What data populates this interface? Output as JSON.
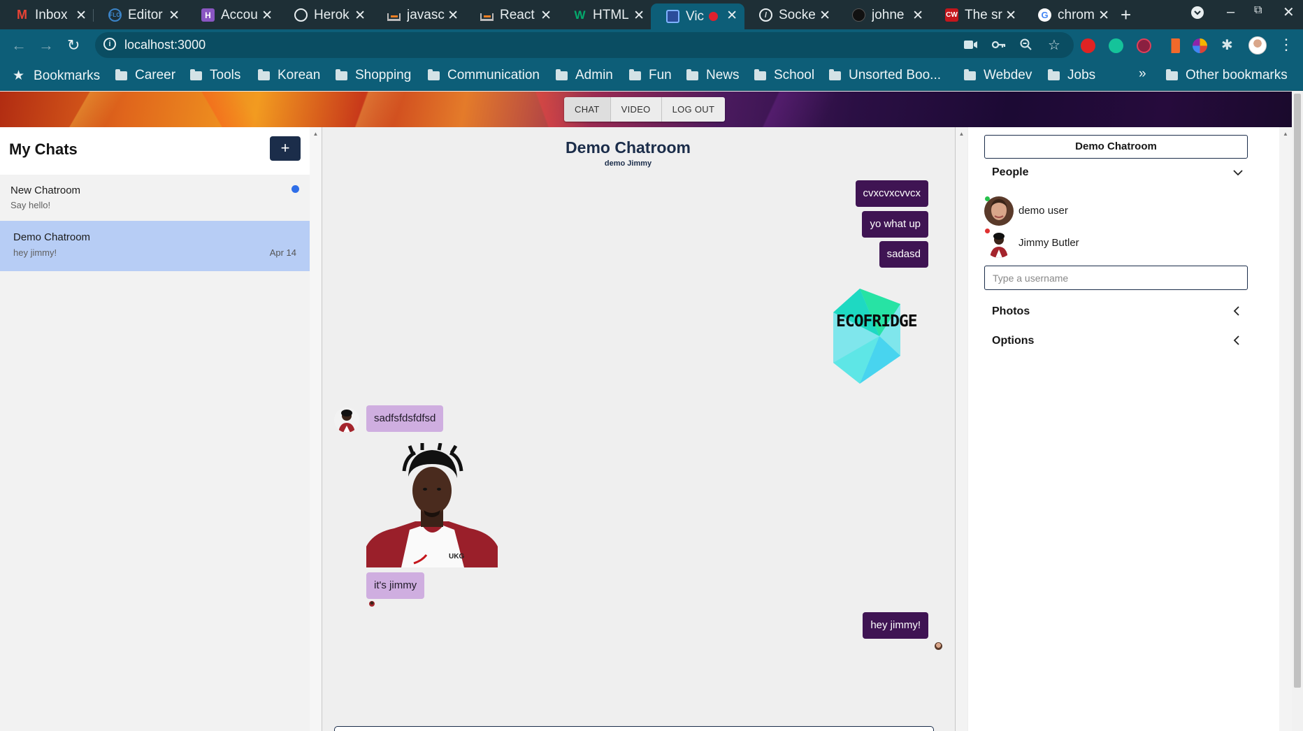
{
  "browser": {
    "tabs": [
      {
        "title": "Inbox",
        "favicon": "gmail-icon",
        "color": "#ea4335",
        "glyph": "M"
      },
      {
        "title": "Editor",
        "favicon": "flo-icon",
        "color": "#3b84c8",
        "glyph": "F"
      },
      {
        "title": "Accou",
        "favicon": "heroku-icon",
        "color": "#8a56c2",
        "glyph": "H"
      },
      {
        "title": "Herok",
        "favicon": "globe-icon",
        "color": "#e8eef0",
        "glyph": ""
      },
      {
        "title": "javasc",
        "favicon": "stackoverflow-icon",
        "color": "#f48024",
        "glyph": ""
      },
      {
        "title": "React",
        "favicon": "stackoverflow-icon",
        "color": "#f48024",
        "glyph": ""
      },
      {
        "title": "HTML",
        "favicon": "w3schools-icon",
        "color": "#04aa6d",
        "glyph": "W"
      },
      {
        "title": "Vic",
        "favicon": "app-icon",
        "color": "#5b8def",
        "glyph": "",
        "active": true,
        "recording": true
      },
      {
        "title": "Socke",
        "favicon": "compass-icon",
        "color": "#e8eef0",
        "glyph": ""
      },
      {
        "title": "johne",
        "favicon": "github-icon",
        "color": "#222",
        "glyph": ""
      },
      {
        "title": "The sr",
        "favicon": "cw-icon",
        "color": "#c4161c",
        "glyph": "CW"
      },
      {
        "title": "chrom",
        "favicon": "google-icon",
        "color": "#ffffff",
        "glyph": "G"
      }
    ],
    "url": "localhost:3000",
    "bookmarks": {
      "star_label": "Bookmarks",
      "folders": [
        "Career",
        "Tools",
        "Korean",
        "Shopping",
        "Communication",
        "Admin",
        "Fun",
        "News",
        "School",
        "Unsorted Boo...",
        "Webdev",
        "Jobs"
      ],
      "overflow": "»",
      "other": "Other bookmarks"
    }
  },
  "navbar": {
    "chat": "CHAT",
    "video": "VIDEO",
    "logout": "LOG OUT"
  },
  "left": {
    "title": "My Chats",
    "add_label": "+",
    "chats": [
      {
        "name": "New Chatroom",
        "last": "Say hello!",
        "date": "",
        "unread": true,
        "selected": false
      },
      {
        "name": "Demo Chatroom",
        "last": "hey jimmy!",
        "date": "Apr 14",
        "unread": false,
        "selected": true
      }
    ]
  },
  "room": {
    "title": "Demo Chatroom",
    "subtitle": "demo Jimmy",
    "messages_out_top": [
      "cvxcvxcvvcx",
      "yo what up",
      "sadasd"
    ],
    "image_logo_text": "ECOFRIDGE",
    "in_msg_1": "sadfsfdsfdfsd",
    "in_msg_2": "it's jimmy",
    "out_msg_last": "hey jimmy!"
  },
  "right": {
    "room_button": "Demo Chatroom",
    "people_label": "People",
    "people": [
      {
        "name": "demo user",
        "online": true
      },
      {
        "name": "Jimmy Butler",
        "online": false
      }
    ],
    "username_placeholder": "Type a username",
    "photos_label": "Photos",
    "options_label": "Options"
  },
  "colors": {
    "accent": "#1b2d4a",
    "out_bubble": "#3f1453",
    "in_bubble": "#cfaee0",
    "selected_chat": "#b7cdf5",
    "online": "#27c24c",
    "offline": "#e03131",
    "unread": "#2f6ee8"
  }
}
